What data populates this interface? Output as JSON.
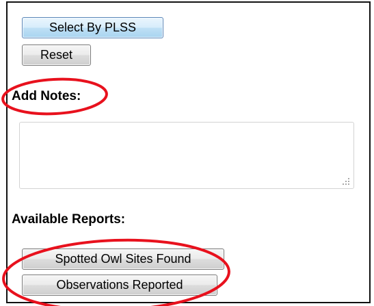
{
  "buttons": {
    "select_by_plss": "Select By PLSS",
    "reset": "Reset"
  },
  "notes": {
    "label": "Add Notes:",
    "value": ""
  },
  "reports": {
    "label": "Available Reports:",
    "items": [
      "Spotted Owl Sites Found",
      "Observations Reported"
    ]
  },
  "colors": {
    "annotation": "#e8111d",
    "primary_button_border": "#5a86b8"
  },
  "icons": {
    "resize_grip": "resize-grip-icon"
  }
}
